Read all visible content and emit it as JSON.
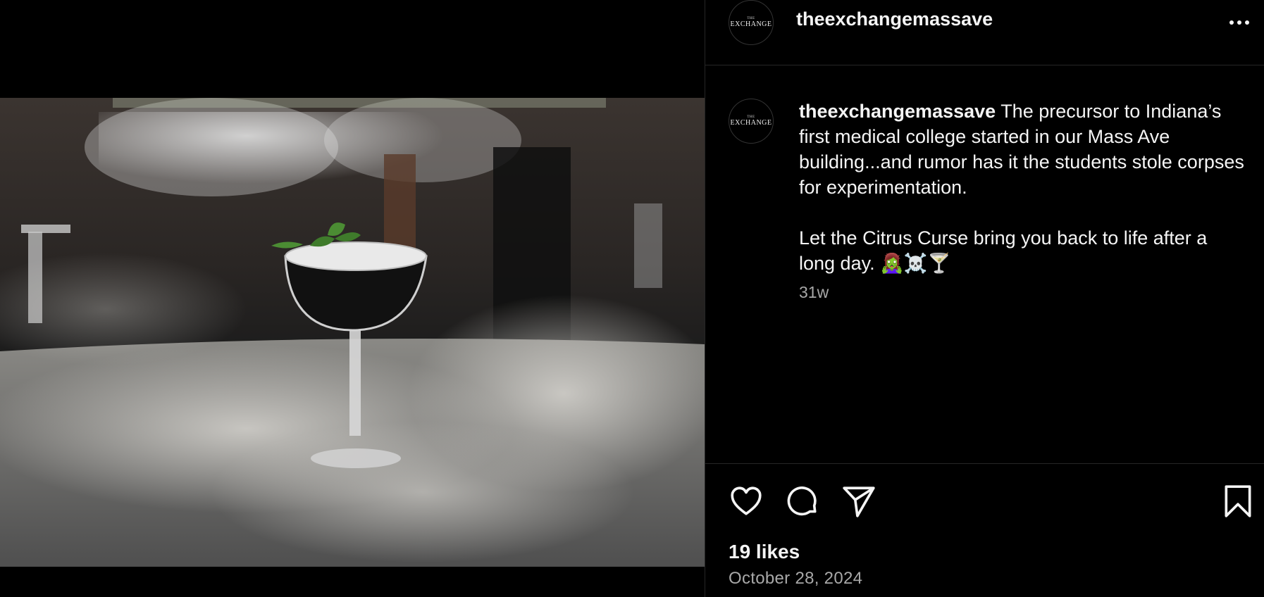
{
  "post": {
    "username": "theexchangemassave",
    "avatar_text_small": "THE",
    "avatar_text_big": "EXCHANGE",
    "caption": {
      "username": "theexchangemassave",
      "paragraph1": "The precursor to Indiana’s first medical college started in our Mass Ave building...and rumor has it the students stole corpses for experimentation.",
      "paragraph2": "Let the Citrus Curse bring you back to life after a long day. 🧟‍♀️☠️🍸"
    },
    "time_ago": "31w",
    "likes": "19 likes",
    "date": "October 28, 2024"
  },
  "icons": {
    "more": "more-options-icon",
    "like": "heart-icon",
    "comment": "comment-icon",
    "share": "share-icon",
    "save": "bookmark-icon"
  },
  "colors": {
    "background": "#000000",
    "text": "#f5f5f5",
    "muted": "#a8a8a8",
    "divider": "#262626"
  }
}
